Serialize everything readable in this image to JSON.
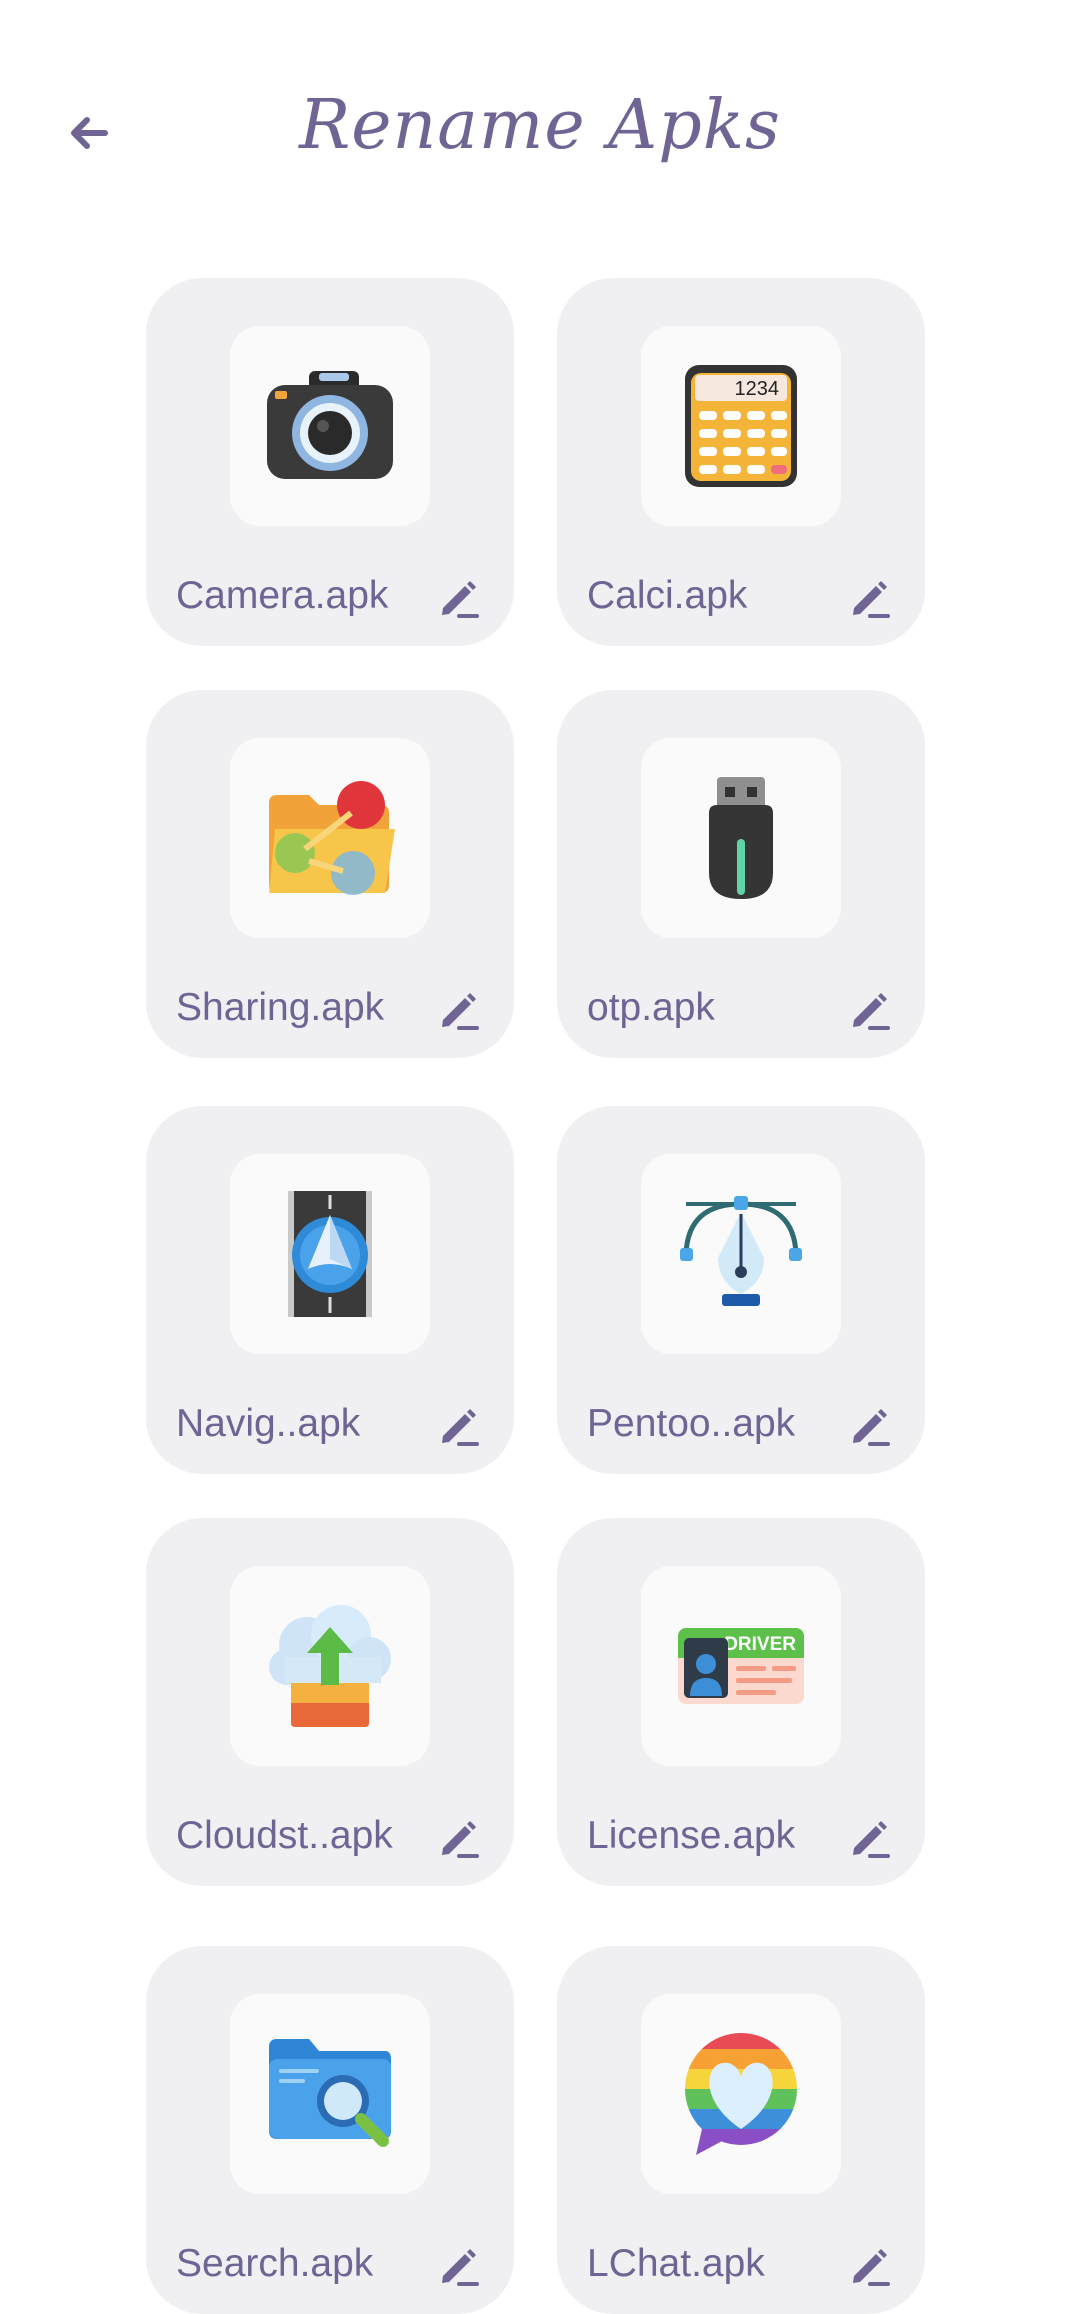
{
  "header": {
    "title": "Rename Apks",
    "back_icon": "arrow-left-icon"
  },
  "accent_color": "#6f6494",
  "card_bg": "#f0f0f2",
  "apks": [
    {
      "name": "Camera.apk",
      "icon": "camera-icon"
    },
    {
      "name": "Calci.apk",
      "icon": "calculator-icon"
    },
    {
      "name": "Sharing.apk",
      "icon": "folder-share-icon"
    },
    {
      "name": "otp.apk",
      "icon": "usb-drive-icon"
    },
    {
      "name": "Navig..apk",
      "icon": "navigation-icon"
    },
    {
      "name": "Pentoo..apk",
      "icon": "pen-tool-icon"
    },
    {
      "name": "Cloudst..apk",
      "icon": "cloud-upload-icon"
    },
    {
      "name": "License.apk",
      "icon": "driver-license-icon"
    },
    {
      "name": "Search.apk",
      "icon": "search-folder-icon"
    },
    {
      "name": "LChat.apk",
      "icon": "chat-heart-icon"
    }
  ],
  "license_card_text": "DRIVER",
  "calculator_display": "1234"
}
